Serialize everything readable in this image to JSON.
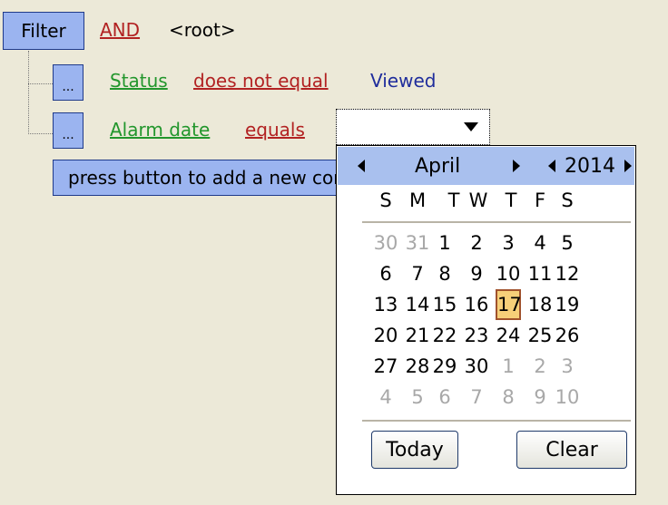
{
  "filter": {
    "button_label": "Filter",
    "operator": "AND",
    "root_label": "<root>"
  },
  "conditions": [
    {
      "button": "...",
      "field": "Status",
      "comparator": "does not equal",
      "value": "Viewed"
    },
    {
      "button": "...",
      "field": "Alarm date",
      "comparator": "equals",
      "value": ""
    }
  ],
  "add_row_text": "press button to add a new condition",
  "calendar": {
    "month": "April",
    "year": "2014",
    "weekdays": [
      "S",
      "M",
      "T",
      "W",
      "T",
      "F",
      "S"
    ],
    "weeks": [
      [
        "30",
        "31",
        "1",
        "2",
        "3",
        "4",
        "5"
      ],
      [
        "6",
        "7",
        "8",
        "9",
        "10",
        "11",
        "12"
      ],
      [
        "13",
        "14",
        "15",
        "16",
        "17",
        "18",
        "19"
      ],
      [
        "20",
        "21",
        "22",
        "23",
        "24",
        "25",
        "26"
      ],
      [
        "27",
        "28",
        "29",
        "30",
        "1",
        "2",
        "3"
      ],
      [
        "4",
        "5",
        "6",
        "7",
        "8",
        "9",
        "10"
      ]
    ],
    "selected_day": "17",
    "today_button": "Today",
    "clear_button": "Clear"
  },
  "colors": {
    "background": "#ece9d8",
    "button_fill": "#9bb4f0",
    "operator_red": "#b22222",
    "field_green": "#22962c",
    "value_navy": "#1f2d9c",
    "calendar_header": "#a9c0ee",
    "selected_day_fill": "#f6cf79"
  },
  "icons": {
    "combo_dropdown": "triangle-down-icon",
    "month_prev": "triangle-left-icon",
    "month_next": "triangle-right-icon",
    "year_prev": "triangle-left-icon",
    "year_next": "triangle-right-icon"
  }
}
